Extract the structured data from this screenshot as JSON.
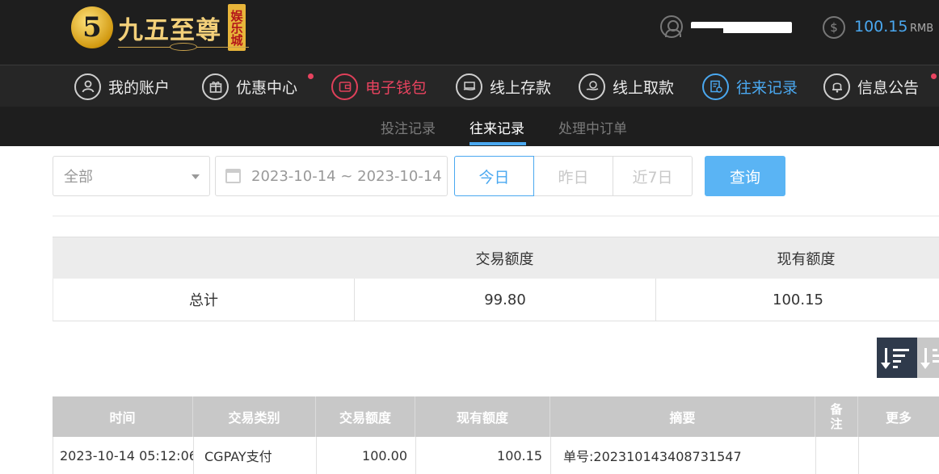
{
  "header": {
    "logo_mark": "5",
    "logo_text": "九五至尊",
    "logo_seal": "娱乐城",
    "balance": "100.15",
    "balance_unit": "RMB"
  },
  "mainnav": {
    "items": [
      {
        "label": "我的账户",
        "icon": "user-circle-icon"
      },
      {
        "label": "优惠中心",
        "icon": "gift-icon"
      },
      {
        "label": "电子钱包",
        "icon": "wallet-icon"
      },
      {
        "label": "线上存款",
        "icon": "deposit-icon"
      },
      {
        "label": "线上取款",
        "icon": "withdraw-icon"
      },
      {
        "label": "往来记录",
        "icon": "records-icon"
      },
      {
        "label": "信息公告",
        "icon": "bell-icon"
      }
    ],
    "colors": {
      "active_red": "#e8435f",
      "active_blue": "#4aa8f0"
    }
  },
  "subnav": {
    "tabs": [
      "投注记录",
      "往来记录",
      "处理中订单"
    ]
  },
  "filters": {
    "type_value": "全部",
    "date_range": "2023-10-14 ~ 2023-10-14",
    "quick": [
      "今日",
      "昨日",
      "近7日"
    ],
    "search_label": "查询"
  },
  "summary": {
    "headers": [
      "",
      "交易额度",
      "现有额度"
    ],
    "row": [
      "总计",
      "99.80",
      "100.15"
    ]
  },
  "records": {
    "headers": [
      "时间",
      "交易类别",
      "交易额度",
      "现有额度",
      "摘要",
      "备",
      "注",
      "更多"
    ],
    "rows": [
      [
        "2023-10-14 05:12:06",
        "CGPAY支付",
        "100.00",
        "100.15",
        "单号:202310143408731547",
        "",
        ""
      ]
    ]
  }
}
